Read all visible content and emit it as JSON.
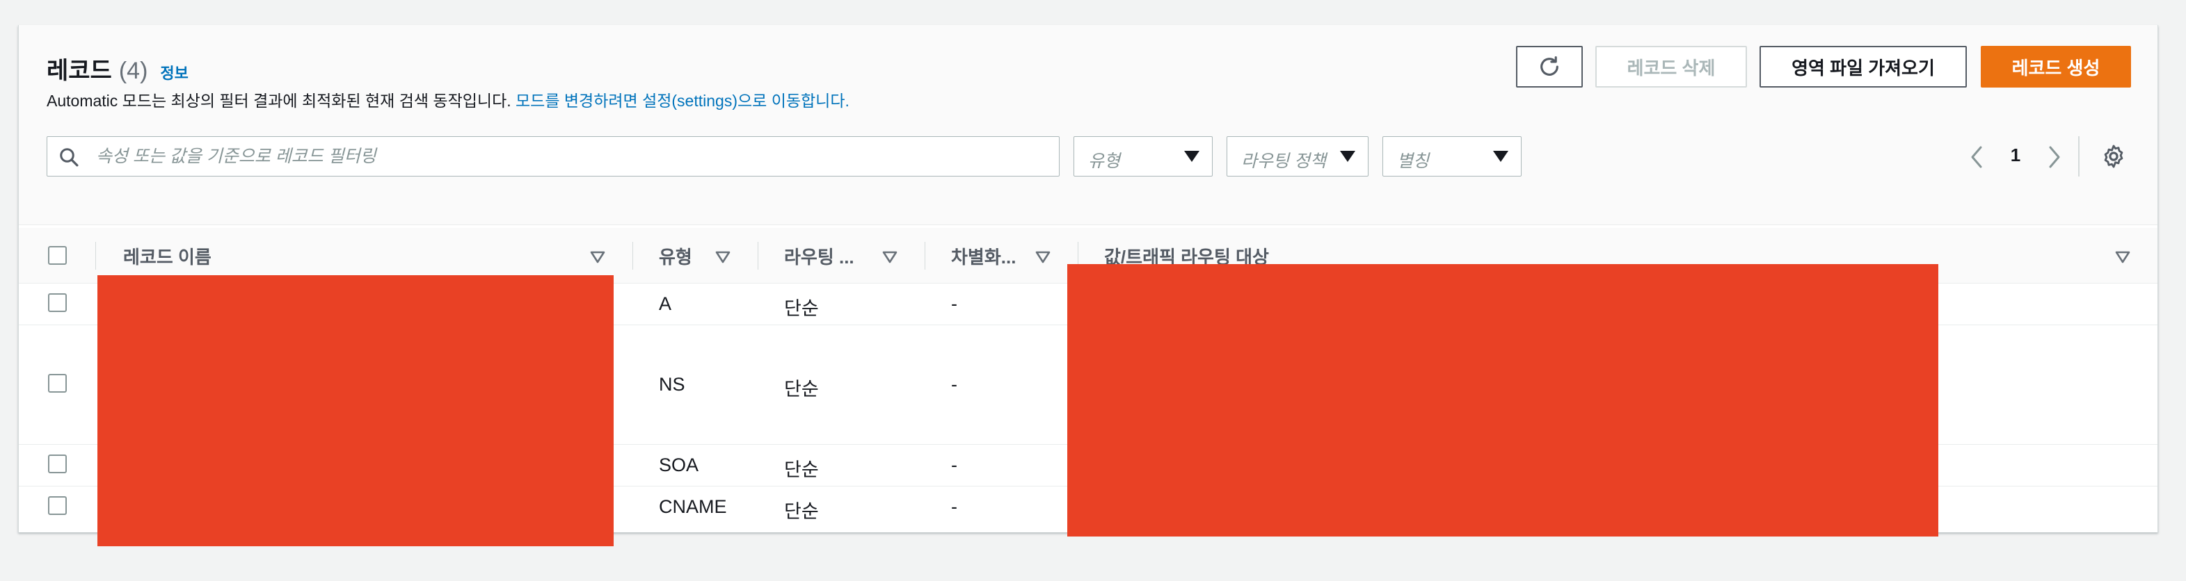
{
  "header": {
    "title": "레코드",
    "count": "(4)",
    "info_link": "정보",
    "description": "Automatic 모드는 최상의 필터 결과에 최적화된 현재 검색 동작입니다. ",
    "description_link": "모드를 변경하려면 설정(settings)으로 이동합니다."
  },
  "toolbar": {
    "refresh_icon": "refresh-icon",
    "delete_label": "레코드 삭제",
    "import_label": "영역 파일 가져오기",
    "create_label": "레코드 생성"
  },
  "filters": {
    "search_placeholder": "속성 또는 값을 기준으로 레코드 필터링",
    "type_placeholder": "유형",
    "routing_placeholder": "라우팅 정책",
    "alias_placeholder": "별칭"
  },
  "pagination": {
    "current_page": "1"
  },
  "table": {
    "columns": {
      "name": "레코드 이름",
      "type": "유형",
      "routing": "라우팅 ...",
      "differentiator": "차별화...",
      "value": "값/트래픽 라우팅 대상"
    },
    "rows": [
      {
        "type": "A",
        "routing": "단순",
        "differentiator": "-"
      },
      {
        "type": "NS",
        "routing": "단순",
        "differentiator": "-"
      },
      {
        "type": "SOA",
        "routing": "단순",
        "differentiator": "-"
      },
      {
        "type": "CNAME",
        "routing": "단순",
        "differentiator": "-"
      }
    ]
  },
  "colors": {
    "primary_button": "#ec7211",
    "link": "#0073bb",
    "redaction": "#e94125"
  }
}
